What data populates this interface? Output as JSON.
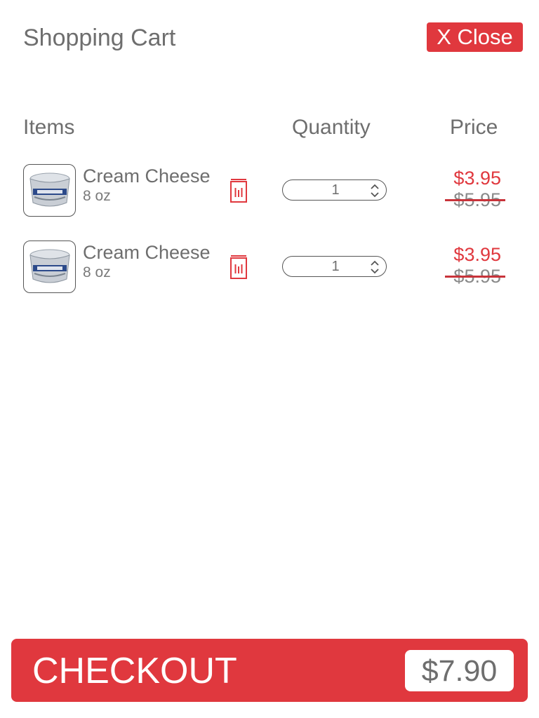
{
  "header": {
    "title": "Shopping Cart",
    "close_label": "X Close"
  },
  "columns": {
    "items": "Items",
    "quantity": "Quantity",
    "price": "Price"
  },
  "cart": {
    "items": [
      {
        "name": "Cream Cheese",
        "size": "8 oz",
        "quantity": "1",
        "sale_price": "$3.95",
        "original_price": "$5.95",
        "icon": "cream-cheese-tub"
      },
      {
        "name": "Cream Cheese",
        "size": "8 oz",
        "quantity": "1",
        "sale_price": "$3.95",
        "original_price": "$5.95",
        "icon": "cream-cheese-tub"
      }
    ]
  },
  "checkout": {
    "label": "CHECKOUT",
    "total": "$7.90"
  },
  "colors": {
    "accent": "#e0383e",
    "text": "#6e6e6e"
  }
}
